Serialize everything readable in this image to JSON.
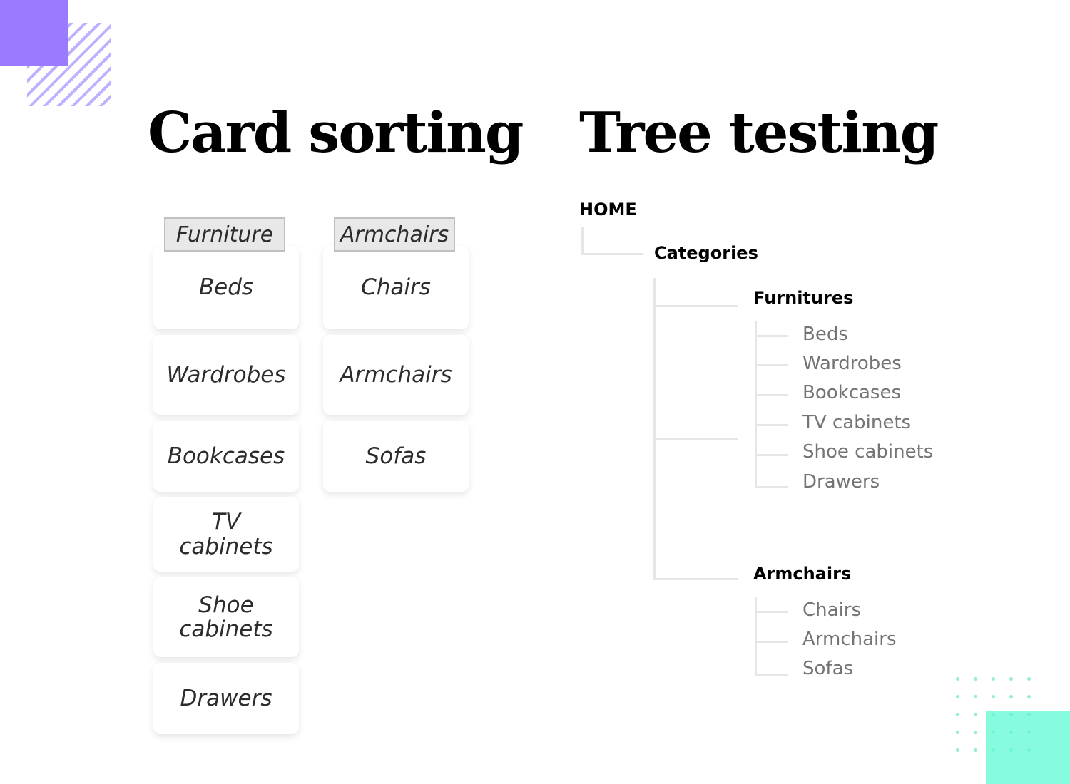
{
  "titles": {
    "card_sorting": "Card sorting",
    "tree_testing": "Tree testing"
  },
  "card_sorting": {
    "groups": [
      {
        "label": "Furniture",
        "cards": [
          "Beds",
          "Wardrobes",
          "Bookcases",
          "TV\ncabinets",
          "Shoe\ncabinets",
          "Drawers"
        ]
      },
      {
        "label": "Armchairs",
        "cards": [
          "Chairs",
          "Armchairs",
          "Sofas"
        ]
      }
    ]
  },
  "tree_testing": {
    "root": "HOME",
    "level1": "Categories",
    "branches": [
      {
        "label": "Furnitures",
        "items": [
          "Beds",
          "Wardrobes",
          "Bookcases",
          "TV cabinets",
          "Shoe cabinets",
          "Drawers"
        ]
      },
      {
        "label": "Armchairs",
        "items": [
          "Chairs",
          "Armchairs",
          "Sofas"
        ]
      }
    ]
  },
  "colors": {
    "purple_accent": "#9a7bff",
    "teal_accent": "#5ffad2",
    "leaf_text": "#747474",
    "connector": "#e6e6e6"
  }
}
